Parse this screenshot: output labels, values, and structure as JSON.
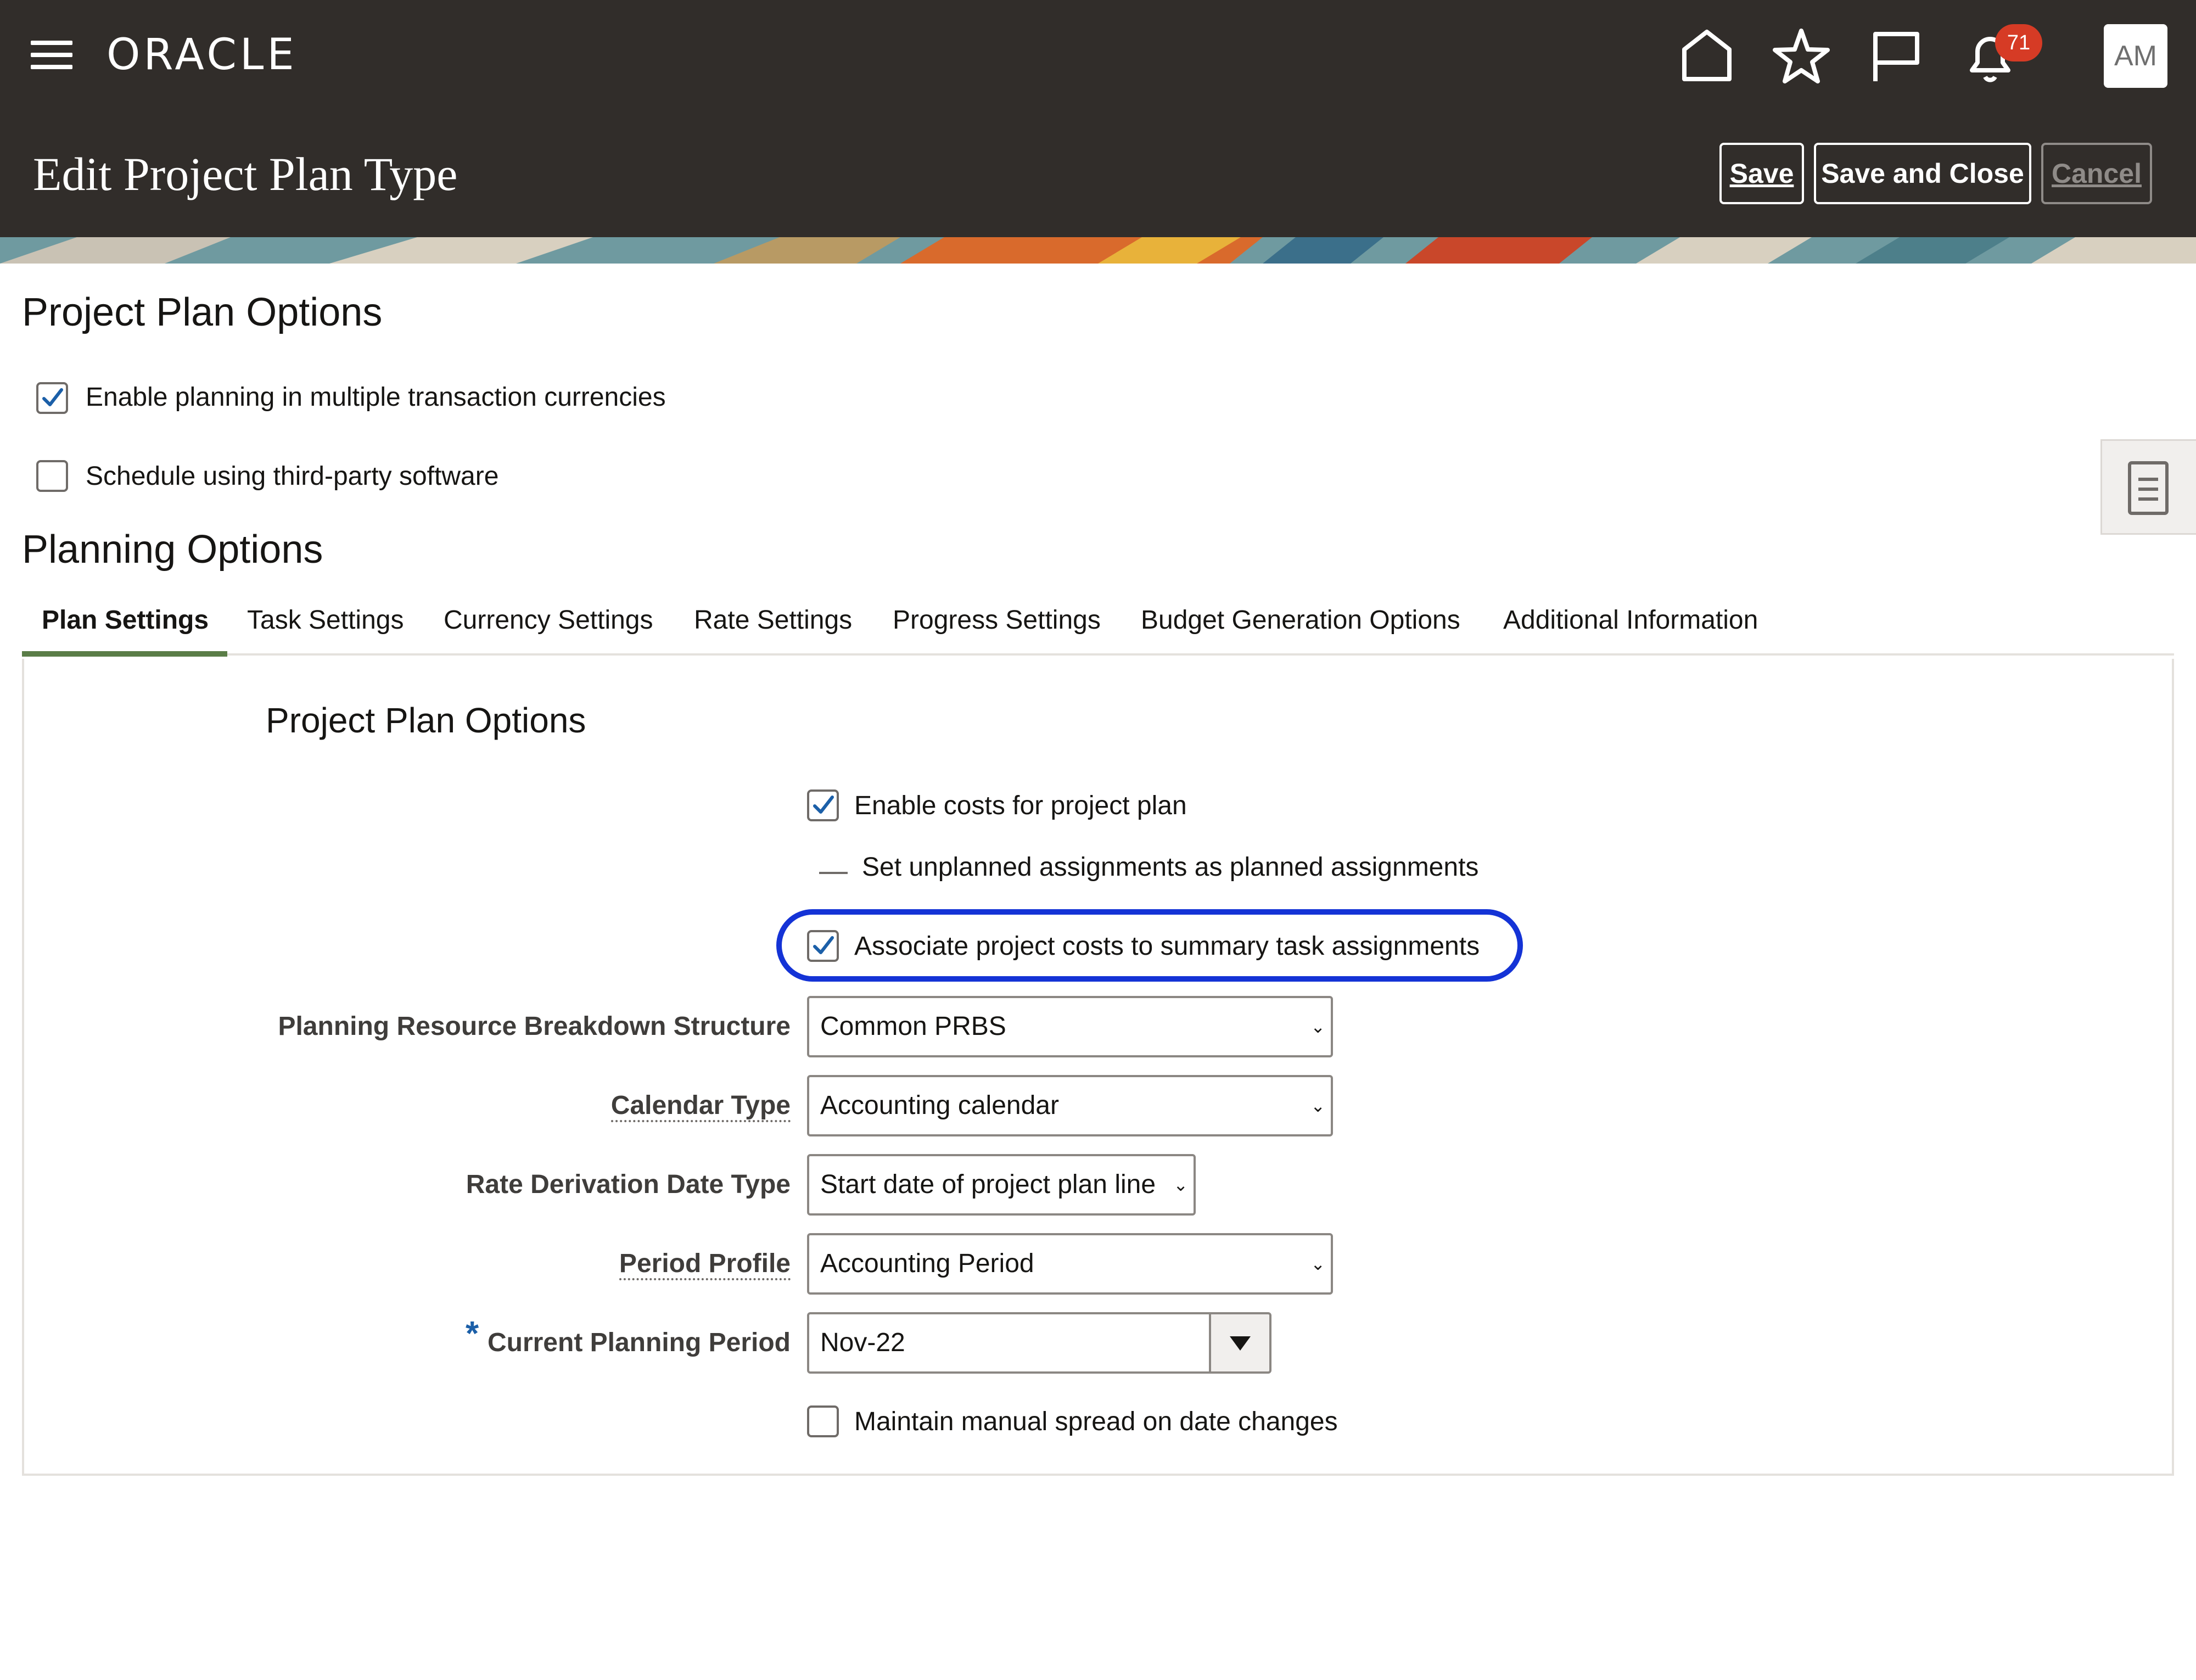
{
  "app": {
    "brand": "ORACLE",
    "notification_count": "71",
    "user_initials": "AM"
  },
  "global_icons": {
    "menu": "hamburger-menu-icon",
    "home": "home-icon",
    "favorites": "star-icon",
    "watchlist": "flag-icon",
    "notifications": "bell-icon"
  },
  "page": {
    "title": "Edit Project Plan Type",
    "buttons": {
      "save": "Save",
      "save_and_close": "Save and Close",
      "cancel": "Cancel"
    }
  },
  "project_plan_options": {
    "heading": "Project Plan Options",
    "enable_multi_currency": {
      "label": "Enable planning in multiple transaction currencies",
      "checked": true
    },
    "third_party_schedule": {
      "label": "Schedule using third-party software",
      "checked": false
    }
  },
  "planning_options": {
    "heading": "Planning Options",
    "tabs": [
      {
        "label": "Plan Settings",
        "active": true
      },
      {
        "label": "Task Settings",
        "active": false
      },
      {
        "label": "Currency Settings",
        "active": false
      },
      {
        "label": "Rate Settings",
        "active": false
      },
      {
        "label": "Progress Settings",
        "active": false
      },
      {
        "label": "Budget Generation Options",
        "active": false
      },
      {
        "label": "Additional Information",
        "active": false
      }
    ]
  },
  "plan_settings": {
    "section_heading": "Project Plan Options",
    "enable_costs": {
      "label": "Enable costs for project plan",
      "checked": true
    },
    "unplanned_as_planned": {
      "label": "Set unplanned assignments as planned assignments"
    },
    "associate_costs_summary": {
      "label": "Associate project costs to summary task assignments",
      "checked": true
    },
    "fields": {
      "prbs": {
        "label": "Planning Resource Breakdown Structure",
        "value": "Common PRBS"
      },
      "calendar_type": {
        "label": "Calendar Type",
        "value": "Accounting calendar"
      },
      "rate_derivation": {
        "label": "Rate Derivation Date Type",
        "value": "Start date of project plan line"
      },
      "period_profile": {
        "label": "Period Profile",
        "value": "Accounting Period"
      },
      "current_period": {
        "label": "Current Planning Period",
        "required_mark": "*",
        "value": "Nov-22"
      }
    },
    "manual_spread": {
      "label": "Maintain manual spread on date changes",
      "checked": false
    }
  },
  "colors": {
    "header_bg": "#312d2a",
    "active_tab_underline": "#5a7d47",
    "highlight_ring": "#1433d6",
    "checkbox_check": "#1b5fa8",
    "badge": "#d63b25"
  }
}
